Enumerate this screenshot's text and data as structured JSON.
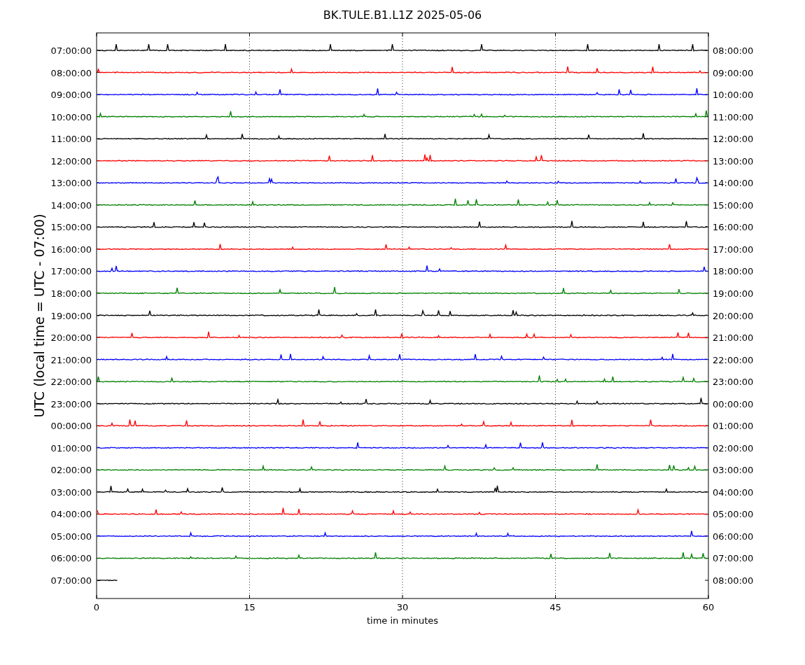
{
  "title": "BK.TULE.B1.L1Z 2025-05-06",
  "ylabel": "UTC (local time = UTC - 07:00)",
  "xlabel": "time in minutes",
  "xticks": [
    "0",
    "15",
    "30",
    "45",
    "60"
  ],
  "traces": [
    {
      "left_label": "07:00:00",
      "right_label": "08:00:00",
      "color": "#000000",
      "level": 1
    },
    {
      "left_label": "08:00:00",
      "right_label": "09:00:00",
      "color": "#ff0000",
      "level": 1
    },
    {
      "left_label": "09:00:00",
      "right_label": "10:00:00",
      "color": "#0000ff",
      "level": 1
    },
    {
      "left_label": "10:00:00",
      "right_label": "11:00:00",
      "color": "#008000",
      "level": 1
    },
    {
      "left_label": "11:00:00",
      "right_label": "12:00:00",
      "color": "#000000",
      "level": 1
    },
    {
      "left_label": "12:00:00",
      "right_label": "13:00:00",
      "color": "#ff0000",
      "level": 1
    },
    {
      "left_label": "13:00:00",
      "right_label": "14:00:00",
      "color": "#0000ff",
      "level": 1
    },
    {
      "left_label": "14:00:00",
      "right_label": "15:00:00",
      "color": "#008000",
      "level": 1
    },
    {
      "left_label": "15:00:00",
      "right_label": "16:00:00",
      "color": "#000000",
      "level": 1
    },
    {
      "left_label": "16:00:00",
      "right_label": "17:00:00",
      "color": "#ff0000",
      "level": 1
    },
    {
      "left_label": "17:00:00",
      "right_label": "18:00:00",
      "color": "#0000ff",
      "level": 1
    },
    {
      "left_label": "18:00:00",
      "right_label": "19:00:00",
      "color": "#008000",
      "level": 1
    },
    {
      "left_label": "19:00:00",
      "right_label": "20:00:00",
      "color": "#000000",
      "level": 1
    },
    {
      "left_label": "20:00:00",
      "right_label": "21:00:00",
      "color": "#ff0000",
      "level": 1
    },
    {
      "left_label": "21:00:00",
      "right_label": "22:00:00",
      "color": "#0000ff",
      "level": 1
    },
    {
      "left_label": "22:00:00",
      "right_label": "23:00:00",
      "color": "#008000",
      "level": 1
    },
    {
      "left_label": "23:00:00",
      "right_label": "00:00:00",
      "color": "#000000",
      "level": 1
    },
    {
      "left_label": "00:00:00",
      "right_label": "01:00:00",
      "color": "#ff0000",
      "level": 1
    },
    {
      "left_label": "01:00:00",
      "right_label": "02:00:00",
      "color": "#0000ff",
      "level": 1
    },
    {
      "left_label": "02:00:00",
      "right_label": "03:00:00",
      "color": "#008000",
      "level": 1
    },
    {
      "left_label": "03:00:00",
      "right_label": "04:00:00",
      "color": "#000000",
      "level": 1
    },
    {
      "left_label": "04:00:00",
      "right_label": "05:00:00",
      "color": "#ff0000",
      "level": 1
    },
    {
      "left_label": "05:00:00",
      "right_label": "06:00:00",
      "color": "#0000ff",
      "level": 1
    },
    {
      "left_label": "06:00:00",
      "right_label": "07:00:00",
      "color": "#008000",
      "level": 1
    },
    {
      "left_label": "07:00:00",
      "right_label": "08:00:00",
      "color": "#000000",
      "level": 0.035
    }
  ]
}
